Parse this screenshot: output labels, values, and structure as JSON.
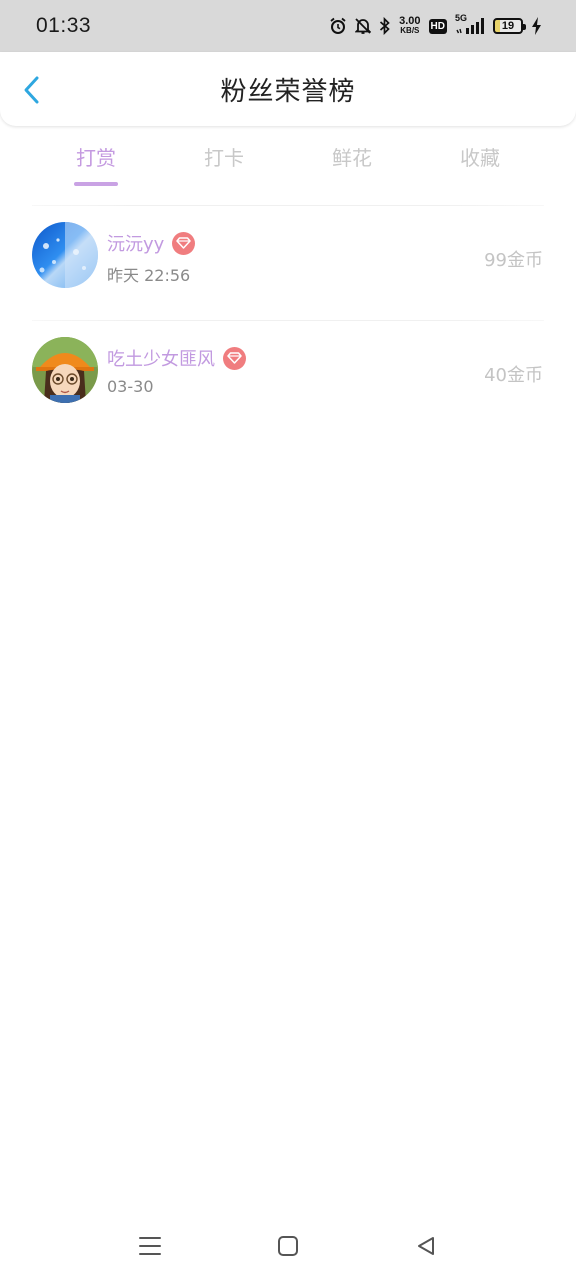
{
  "status_bar": {
    "time": "01:33",
    "net_speed_value": "3.00",
    "net_speed_unit": "KB/S",
    "hd_label": "HD",
    "network_label": "5G",
    "battery_level": "19",
    "icons": [
      "alarm-icon",
      "bell-off-icon",
      "bluetooth-icon",
      "signal-icon",
      "charging-icon"
    ]
  },
  "header": {
    "title": "粉丝荣誉榜",
    "back_icon": "chevron-left-icon"
  },
  "tabs": [
    {
      "label": "打赏",
      "active": true
    },
    {
      "label": "打卡",
      "active": false
    },
    {
      "label": "鲜花",
      "active": false
    },
    {
      "label": "收藏",
      "active": false
    }
  ],
  "fans": [
    {
      "name": "沅沅yy",
      "time": "昨天 22:56",
      "amount": "99金币",
      "badge_icon": "diamond-icon"
    },
    {
      "name": "吃土少女匪风",
      "time": "03-30",
      "amount": "40金币",
      "badge_icon": "diamond-icon"
    }
  ],
  "nav_bar": {
    "buttons": [
      "menu-icon",
      "home-icon",
      "back-triangle-icon"
    ]
  },
  "colors": {
    "accent": "#c49ae0",
    "back_arrow": "#2ea7e0",
    "badge": "#f07d7f",
    "status_bar_bg": "#d9d9d9"
  }
}
